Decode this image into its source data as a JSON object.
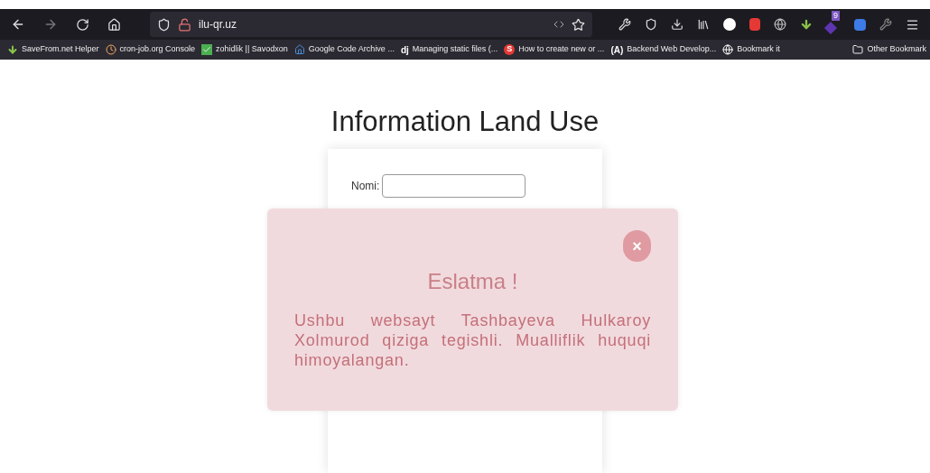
{
  "browser": {
    "url": "ilu-qr.uz",
    "extension_badge": "9",
    "bookmarks": [
      {
        "label": "SaveFrom.net Helper",
        "kind": "download"
      },
      {
        "label": "cron-job.org Console",
        "kind": "clock"
      },
      {
        "label": "zohidlik || Savodxon",
        "kind": "check"
      },
      {
        "label": "Google Code Archive ...",
        "kind": "home"
      },
      {
        "label": "Managing static files (...",
        "kind": "letter",
        "icon_text": "dj"
      },
      {
        "label": "How to create new or ...",
        "kind": "letter-red",
        "icon_text": "S"
      },
      {
        "label": "Backend Web Develop...",
        "kind": "letter",
        "icon_text": "(A)"
      },
      {
        "label": "Bookmark it",
        "kind": "globe"
      }
    ],
    "other_bookmarks": "Other Bookmark"
  },
  "page": {
    "title": "Information Land Use",
    "name_label": "Nomi:"
  },
  "modal": {
    "close": "×",
    "heading": "Eslatma !",
    "message": "Ushbu websayt Tashbayeva Hulkaroy Xolmurod qiziga tegishli. Mualliflik huquqi himoyalangan."
  }
}
